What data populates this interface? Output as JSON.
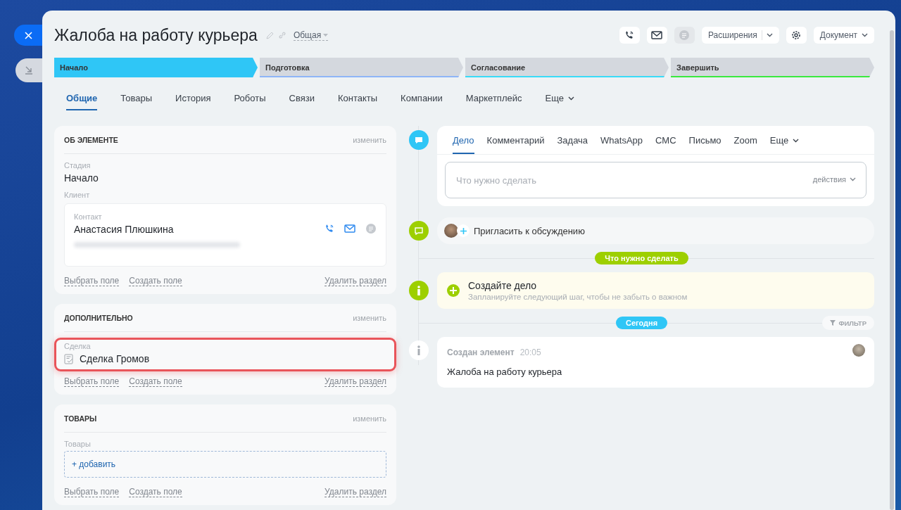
{
  "title": "Жалоба на работу курьера",
  "category": "Общая",
  "toolbar": {
    "chat_disabled": true,
    "extensions": "Расширения",
    "document": "Документ"
  },
  "stages": [
    {
      "label": "Начало",
      "color": "#2fc6f6",
      "selected": true
    },
    {
      "label": "Подготовка",
      "color": "#8eb5f7",
      "selected": false
    },
    {
      "label": "Согласование",
      "color": "#39dbf7",
      "selected": false
    },
    {
      "label": "Завершить",
      "color": "#3ae93e",
      "selected": false
    }
  ],
  "tabs": [
    {
      "label": "Общие",
      "selected": true
    },
    {
      "label": "Товары",
      "selected": false
    },
    {
      "label": "История",
      "selected": false
    },
    {
      "label": "Роботы",
      "selected": false
    },
    {
      "label": "Связи",
      "selected": false
    },
    {
      "label": "Контакты",
      "selected": false
    },
    {
      "label": "Компании",
      "selected": false
    },
    {
      "label": "Маркетплейс",
      "selected": false
    }
  ],
  "tabs_more": "Еще",
  "sections": [
    {
      "kind": "about",
      "title": "ОБ ЭЛЕМЕНТЕ",
      "edit": "изменить",
      "stage_label": "Стадия",
      "stage_value": "Начало",
      "client_label": "Клиент",
      "contact_label": "Контакт",
      "contact_name": "Анастасия Плюшкина",
      "links": [
        "Выбрать поле",
        "Создать поле"
      ],
      "delete": "Удалить раздел"
    },
    {
      "kind": "extra",
      "title": "ДОПОЛНИТЕЛЬНО",
      "edit": "изменить",
      "field_label": "Сделка",
      "field_value": "Сделка Громов",
      "highlighted": true,
      "links": [
        "Выбрать поле",
        "Создать поле"
      ],
      "delete": "Удалить раздел"
    },
    {
      "kind": "products",
      "title": "ТОВАРЫ",
      "edit": "изменить",
      "field_label": "Товары",
      "add": "+ добавить",
      "links": [
        "Выбрать поле",
        "Создать поле"
      ],
      "delete": "Удалить раздел"
    }
  ],
  "activity": {
    "tabs": [
      {
        "label": "Дело",
        "selected": true
      },
      {
        "label": "Комментарий",
        "selected": false
      },
      {
        "label": "Задача",
        "selected": false
      },
      {
        "label": "WhatsApp",
        "selected": false
      },
      {
        "label": "СМС",
        "selected": false
      },
      {
        "label": "Письмо",
        "selected": false
      },
      {
        "label": "Zoom",
        "selected": false
      }
    ],
    "more": "Еще",
    "placeholder": "Что нужно сделать",
    "actions": "действия"
  },
  "invite": "Пригласить к обсуждению",
  "todo_badge": "Что нужно сделать",
  "create": {
    "title": "Создайте дело",
    "hint": "Запланируйте следующий шаг, чтобы не забыть о важном"
  },
  "today_badge": "Сегодня",
  "filter": "ФИЛЬТР",
  "event": {
    "title": "Создан элемент",
    "time": "20:05",
    "text": "Жалоба на работу курьера"
  }
}
